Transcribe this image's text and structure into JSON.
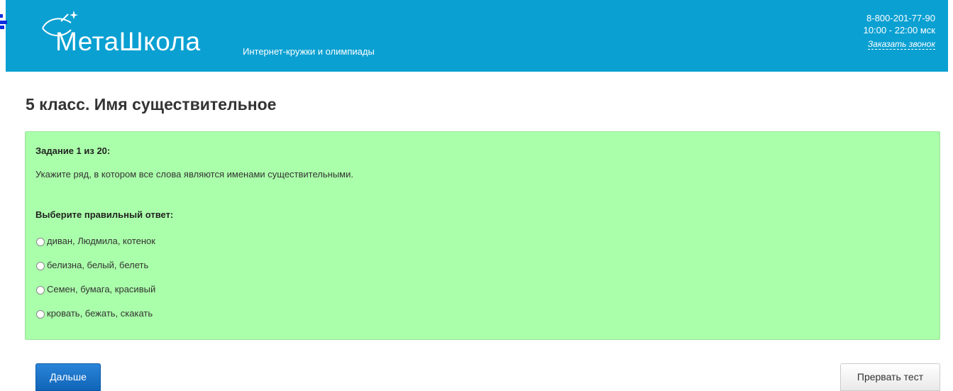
{
  "header": {
    "logo_text": "МетаШкола",
    "tagline": "Интернет-кружки и олимпиады",
    "phone": "8-800-201-77-90",
    "hours": "10:00 - 22:00 мск",
    "callback_link": "Заказать звонок"
  },
  "page_title": "5 класс. Имя существительное",
  "task": {
    "counter": "Задание 1 из 20:",
    "question": "Укажите ряд, в котором все слова являются именами существительными.",
    "prompt": "Выберите правильный ответ:",
    "options": [
      "диван, Людмила, котенок",
      "белизна, белый, белеть",
      "Семен, бумага, красивый",
      "кровать, бежать, скакать"
    ]
  },
  "buttons": {
    "next": "Дальше",
    "abort": "Прервать тест"
  },
  "colors": {
    "header_bg": "#0aa0d2",
    "panel_bg": "#aaffaa",
    "primary_button": "#1a74c8"
  }
}
